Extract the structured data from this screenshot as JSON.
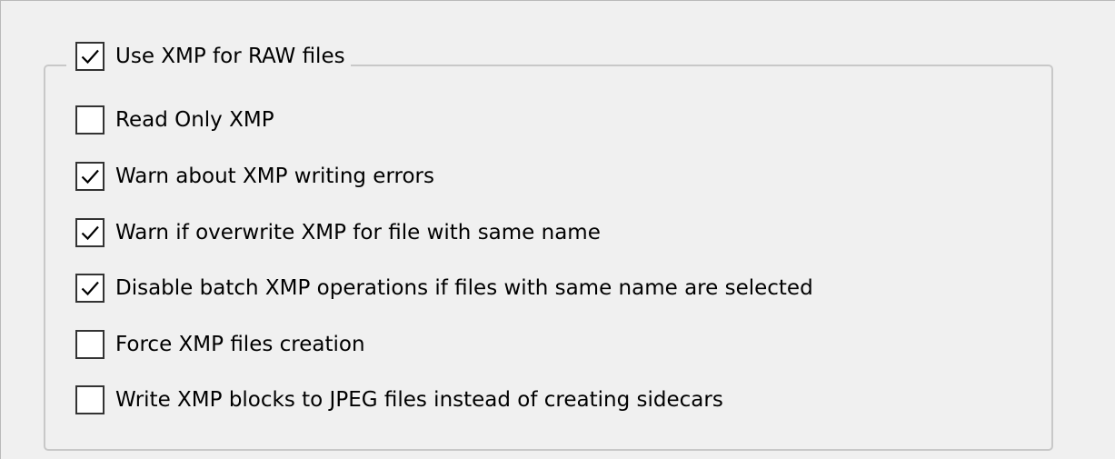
{
  "xmp_settings": {
    "use_xmp_for_raw": {
      "label": "Use XMP for RAW files",
      "checked": true
    },
    "options": [
      {
        "label": "Read Only XMP",
        "checked": false
      },
      {
        "label": "Warn about XMP writing errors",
        "checked": true
      },
      {
        "label": "Warn if overwrite XMP for file with same name",
        "checked": true
      },
      {
        "label": "Disable batch XMP operations if files with same name are selected",
        "checked": true
      },
      {
        "label": "Force XMP files creation",
        "checked": false
      },
      {
        "label": "Write XMP blocks to JPEG files instead of creating sidecars",
        "checked": false
      }
    ]
  },
  "icons": {
    "check": "checkmark-icon"
  },
  "colors": {
    "background": "#f0f0f0",
    "group_border": "#c8c8c8",
    "checkbox_border": "#333333",
    "checkbox_fill": "#ffffff",
    "check_mark": "#000000"
  }
}
